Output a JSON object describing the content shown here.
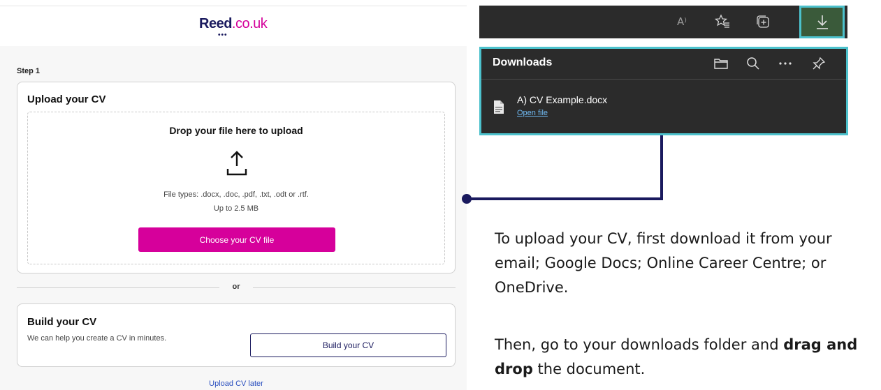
{
  "reed": {
    "logo_main": "Reed",
    "logo_suffix": ".co.uk",
    "logo_dots": "•••",
    "step_label": "Step 1",
    "upload_card": {
      "title": "Upload your CV",
      "drop_title": "Drop your file here to upload",
      "file_types": "File types: .docx, .doc, .pdf, .txt, .odt or .rtf.",
      "max_size": "Up to 2.5 MB",
      "choose_button": "Choose your CV file"
    },
    "or_label": "or",
    "build_card": {
      "title": "Build your CV",
      "description": "We can help you create a CV in minutes.",
      "build_button": "Build your CV"
    },
    "upload_later_link": "Upload CV later",
    "brand_color": "#d6009b"
  },
  "browser": {
    "toolbar_icons": [
      "read-aloud-icon",
      "favorites-icon",
      "collections-icon",
      "downloads-icon"
    ],
    "read_aloud_glyph": "A⁾",
    "downloads_panel": {
      "title": "Downloads",
      "header_icons": [
        "folder-icon",
        "search-icon",
        "more-icon",
        "pin-icon"
      ],
      "items": [
        {
          "file_name": "A) CV Example.docx",
          "action": "Open file"
        }
      ]
    },
    "highlight_color": "#4cc1cc"
  },
  "instructions": {
    "line1": "To upload your CV, first download it from your email; Google Docs; Online Career Centre; or OneDrive.",
    "line2_before": "Then, go to your downloads folder and ",
    "line2_bold": "drag and drop",
    "line2_after": " the document."
  }
}
